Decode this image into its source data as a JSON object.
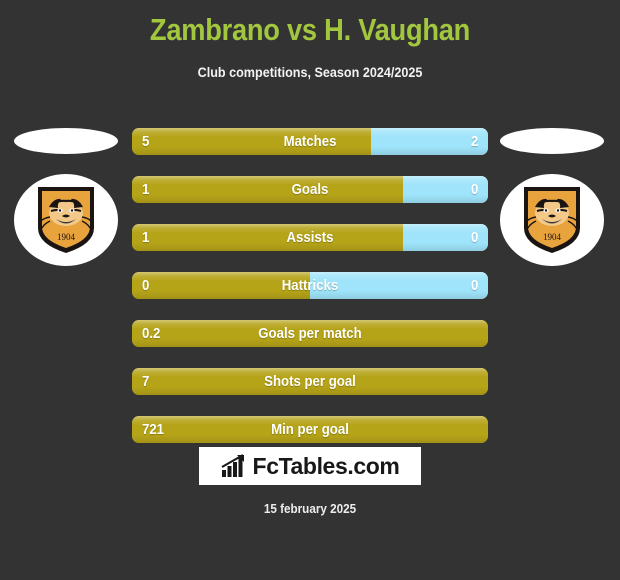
{
  "header": {
    "title": "Zambrano vs H. Vaughan",
    "subtitle": "Club competitions, Season 2024/2025",
    "title_color": "#a2c73f",
    "subtitle_color": "#f2f2f2"
  },
  "crests": {
    "home": {
      "name": "hull-city-crest-icon",
      "year": "1904",
      "primary_color": "#e8a33d",
      "outline_color": "#1a1412"
    },
    "away": {
      "name": "hull-city-crest-icon",
      "year": "1904",
      "primary_color": "#e8a33d",
      "outline_color": "#1a1412"
    }
  },
  "colors": {
    "background": "#333333",
    "home_bar": "#b5a318",
    "away_bar": "#9fe4fa",
    "bar_text": "#ffffff"
  },
  "chart_data": {
    "type": "bar",
    "title": "Zambrano vs H. Vaughan",
    "subtitle": "Club competitions, Season 2024/2025",
    "orientation": "horizontal-diverging",
    "series": [
      {
        "name": "Zambrano",
        "color": "#b5a318"
      },
      {
        "name": "H. Vaughan",
        "color": "#9fe4fa"
      }
    ],
    "categories": [
      "Matches",
      "Goals",
      "Assists",
      "Hattricks",
      "Goals per match",
      "Shots per goal",
      "Min per goal"
    ],
    "rows": [
      {
        "label": "Matches",
        "home": "5",
        "away": "2",
        "home_pct": 67,
        "split": true
      },
      {
        "label": "Goals",
        "home": "1",
        "away": "0",
        "home_pct": 76,
        "split": true
      },
      {
        "label": "Assists",
        "home": "1",
        "away": "0",
        "home_pct": 76,
        "split": true
      },
      {
        "label": "Hattricks",
        "home": "0",
        "away": "0",
        "home_pct": 50,
        "split": true
      },
      {
        "label": "Goals per match",
        "home": "0.2",
        "away": "",
        "home_pct": 100,
        "split": false
      },
      {
        "label": "Shots per goal",
        "home": "7",
        "away": "",
        "home_pct": 100,
        "split": false
      },
      {
        "label": "Min per goal",
        "home": "721",
        "away": "",
        "home_pct": 100,
        "split": false
      }
    ]
  },
  "footer": {
    "brand": "FcTables.com",
    "brand_icon": "bar-chart-growth-icon",
    "date": "15 february 2025"
  }
}
